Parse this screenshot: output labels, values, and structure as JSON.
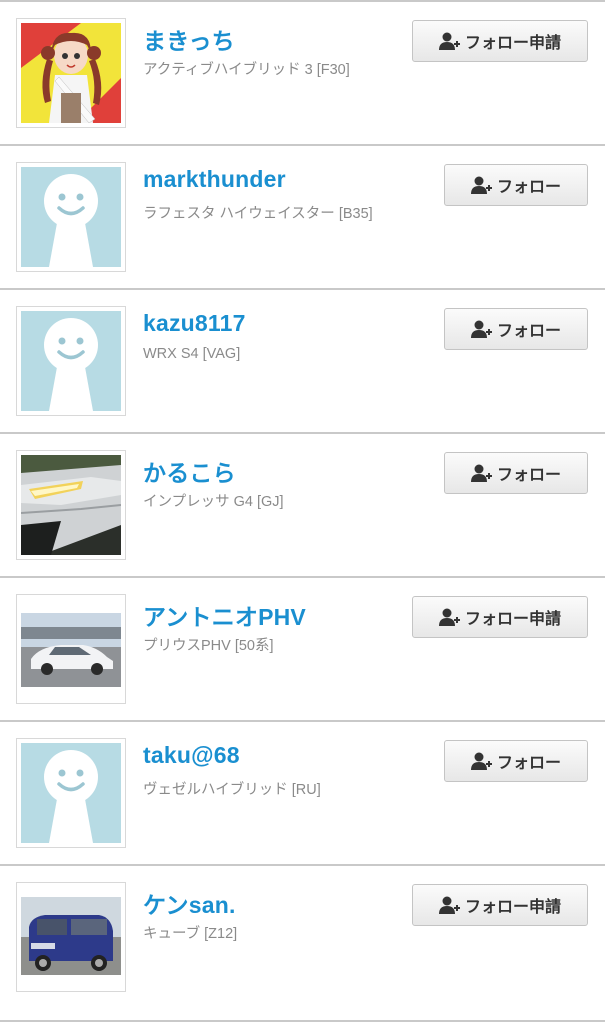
{
  "users": [
    {
      "name": "まきっち",
      "car": "アクティブハイブリッド 3 [F30]",
      "button": "フォロー申請",
      "avatar": "anime-illustration"
    },
    {
      "name": "markthunder",
      "car": "ラフェスタ ハイウェイスター [B35]",
      "button": "フォロー",
      "avatar": "default-smiley"
    },
    {
      "name": "kazu8117",
      "car": "WRX S4 [VAG]",
      "button": "フォロー",
      "avatar": "default-smiley"
    },
    {
      "name": "かるこら",
      "car": "インプレッサ G4 [GJ]",
      "button": "フォロー",
      "avatar": "car-headlight-photo"
    },
    {
      "name": "アントニオPHV",
      "car": "プリウスPHV [50系]",
      "button": "フォロー申請",
      "avatar": "white-car-photo"
    },
    {
      "name": "taku@68",
      "car": "ヴェゼルハイブリッド [RU]",
      "button": "フォロー",
      "avatar": "default-smiley"
    },
    {
      "name": "ケンsan.",
      "car": "キューブ [Z12]",
      "button": "フォロー申請",
      "avatar": "blue-car-photo"
    }
  ],
  "colors": {
    "name": "#1a8fd0",
    "subtext": "#8a8a8a",
    "divider": "#c9c9c9",
    "default_avatar_bg": "#b7dbe4"
  }
}
